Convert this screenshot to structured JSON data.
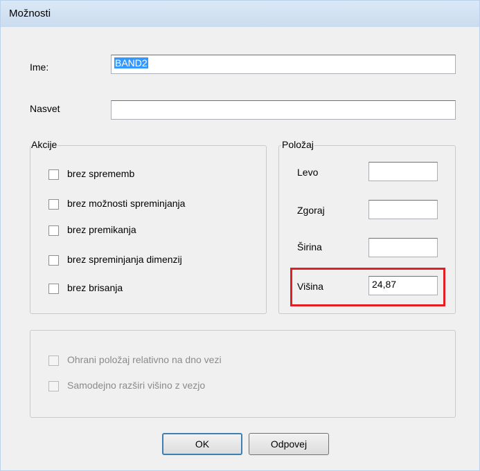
{
  "window": {
    "title": "Možnosti"
  },
  "fields": {
    "ime_label": "Ime:",
    "ime_value": "BAND2",
    "nasvet_label": "Nasvet",
    "nasvet_value": ""
  },
  "akcije": {
    "title": "Akcije",
    "items": [
      {
        "label": "brez sprememb",
        "checked": false
      },
      {
        "label": "brez možnosti spreminjanja",
        "checked": false
      },
      {
        "label": "brez premikanja",
        "checked": false
      },
      {
        "label": "brez spreminjanja dimenzij",
        "checked": false
      },
      {
        "label": "brez brisanja",
        "checked": false
      }
    ]
  },
  "polozaj": {
    "title": "Položaj",
    "levo_label": "Levo",
    "levo_value": "",
    "zgoraj_label": "Zgoraj",
    "zgoraj_value": "",
    "sirina_label": "Širina",
    "sirina_value": "",
    "visina_label": "Višina",
    "visina_value": "24,87"
  },
  "options": {
    "items": [
      {
        "label": "Ohrani položaj relativno na dno vezi",
        "checked": false,
        "enabled": false
      },
      {
        "label": "Samodejno razširi višino z vezjo",
        "checked": false,
        "enabled": false
      }
    ]
  },
  "buttons": {
    "ok": "OK",
    "cancel": "Odpovej"
  },
  "colors": {
    "highlight": "#e01e24",
    "selection": "#3399ff"
  }
}
